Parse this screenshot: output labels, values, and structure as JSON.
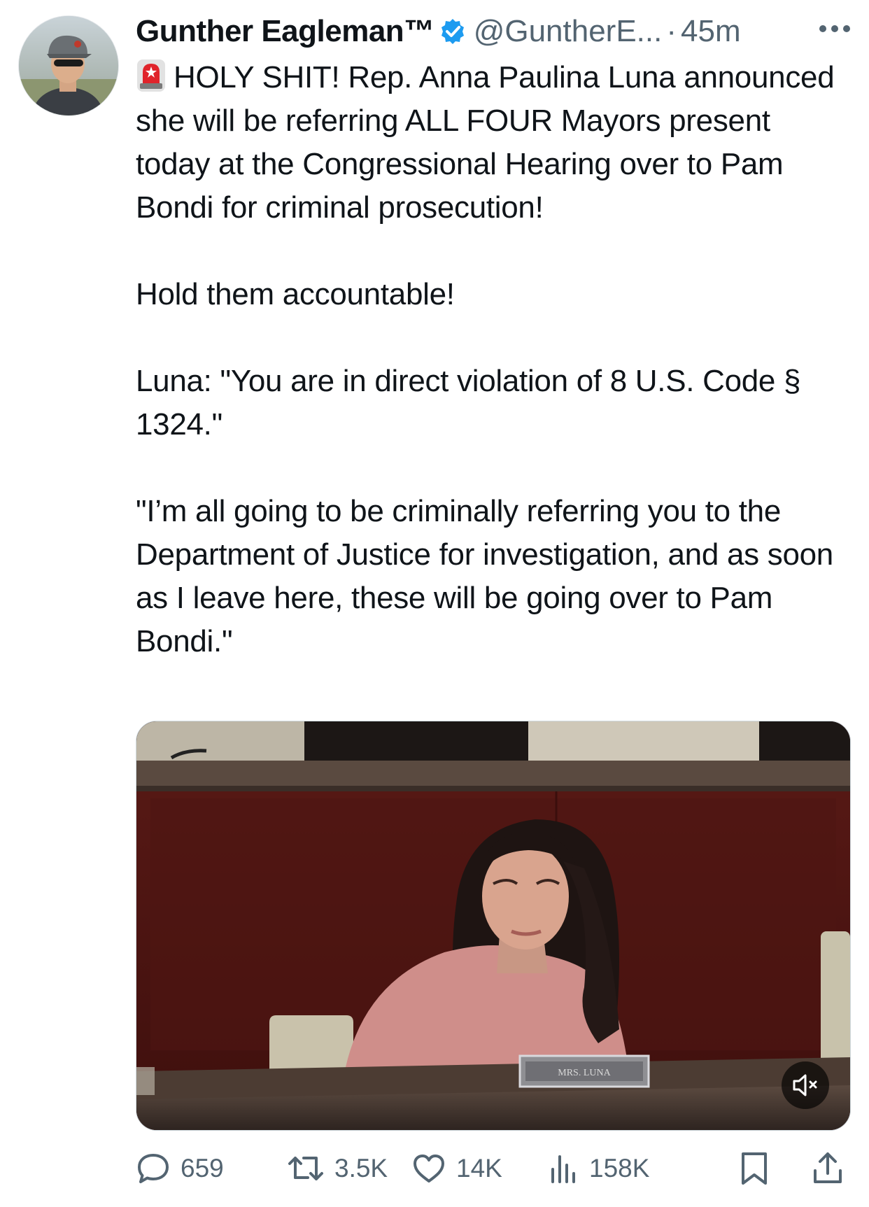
{
  "tweet": {
    "display_name": "Gunther Eagleman™",
    "handle": "@GuntherE...",
    "separator": "·",
    "time": "45m",
    "paragraphs": [
      "HOLY SHIT! Rep. Anna Paulina Luna announced she will be referring ALL FOUR Mayors present today at the Congressional Hearing over to Pam Bondi for criminal prosecution!",
      "Hold them accountable!",
      "Luna: \"You are in direct violation of 8 U.S. Code § 1324.\"",
      "\"I’m all going to be criminally referring you to the Department of Justice for investigation, and as soon as I leave here, these will be going over to Pam Bondi.\""
    ],
    "lead_emoji": "siren-icon",
    "media": {
      "type": "video",
      "nameplate_text": "MRS. LUNA",
      "muted": true
    }
  },
  "actions": {
    "replies": "659",
    "reposts": "3.5K",
    "likes": "14K",
    "views": "158K"
  },
  "colors": {
    "text": "#0f1419",
    "secondary": "#536471",
    "verified": "#1d9bf0"
  }
}
